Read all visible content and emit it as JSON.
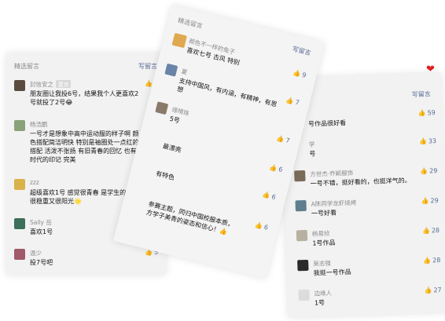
{
  "left": {
    "header": "精选留言",
    "write": "写留言",
    "comments": [
      {
        "name": "封信安之",
        "badge": "置顶",
        "lines": [
          "朋友圈让我投6号，结果我个人更喜欢2",
          "号就投了2号😂"
        ],
        "likes": "3"
      },
      {
        "name": "杨浩鹏",
        "lines": [
          "一号才是想象中高中运动服的样子啊 颜",
          "色搭配简洁明快 特别是袖圈处一点红的",
          "搭配 活泼不张扬 有旧青春的回忆 也有新",
          "时代的印记 完美"
        ],
        "likes": "8"
      },
      {
        "name": "zzz",
        "lines": [
          "超级喜欢1号 感觉很青春 是学生的样子",
          "很稳重又很阳光🌟"
        ],
        "likes": "7"
      },
      {
        "name": "Sally 岳",
        "lines": [
          "喜欢1号"
        ],
        "likes": "6"
      },
      {
        "name": "温少",
        "lines": [
          "投7号吧"
        ],
        "likes": "5"
      }
    ]
  },
  "middle": {
    "header": "精选留言",
    "write": "写留言",
    "comments": [
      {
        "name": "颜色不一样的兔子",
        "lines": [
          "喜欢七号 古风 特别"
        ],
        "likes": "9"
      },
      {
        "name": "夏",
        "lines": [
          "支持中国风，有内涵，有精神，有思",
          "想"
        ],
        "likes": "7"
      },
      {
        "name": "缘晴珠",
        "lines": [
          "5号"
        ],
        "likes": "7"
      },
      {
        "name": "",
        "lines": [
          "最漂亮"
        ],
        "likes": "6"
      },
      {
        "name": "",
        "lines": [
          "有特色"
        ],
        "likes": "6"
      },
      {
        "name": "",
        "lines": [
          "参赛主题，同归中国校服本质，",
          "方学子美青的姿态和信心！👍"
        ],
        "likes": "6"
      }
    ]
  },
  "right": {
    "header": "写留言",
    "comments": [
      {
        "name": "",
        "lines": [
          "号作品很好看"
        ],
        "likes": "59"
      },
      {
        "name": "学",
        "lines": [
          "号"
        ],
        "likes": "33"
      },
      {
        "name": "方世杰·乔颖服饰",
        "lines": [
          "一号不错，挺好看的，也挺洋气的。"
        ],
        "likes": "29"
      },
      {
        "name": "A陈同学龙虾烧烤",
        "lines": [
          "一号好看"
        ],
        "likes": "29"
      },
      {
        "name": "杨易欣",
        "lines": [
          "1号作品"
        ],
        "likes": "28"
      },
      {
        "name": "吴志强",
        "lines": [
          "我挺一号作品"
        ],
        "likes": "28"
      },
      {
        "name": "边缘人",
        "lines": [
          "1号"
        ],
        "likes": "27"
      }
    ]
  }
}
